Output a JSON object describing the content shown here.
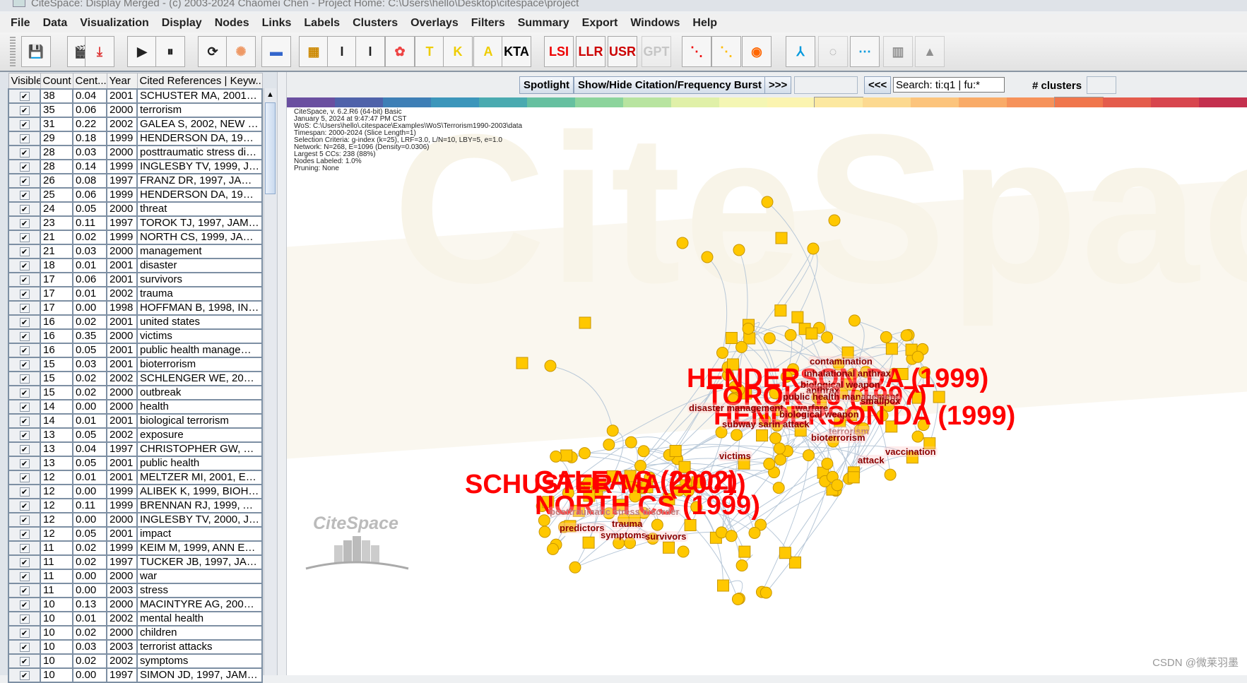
{
  "window": {
    "title": "CiteSpace: Display Merged - (c) 2003-2024 Chaomei Chen - Project Home: C:\\Users\\hello\\Desktop\\citespace\\project"
  },
  "menu": [
    "File",
    "Data",
    "Visualization",
    "Display",
    "Nodes",
    "Links",
    "Labels",
    "Clusters",
    "Overlays",
    "Filters",
    "Summary",
    "Export",
    "Windows",
    "Help"
  ],
  "toolbar": [
    {
      "icon": "save-icon",
      "label": ""
    },
    {
      "icon": "clapperboard-icon",
      "label": ""
    },
    {
      "icon": "pdf-export-icon",
      "label": ""
    },
    {
      "icon": "play-icon",
      "label": ""
    },
    {
      "icon": "pause-icon",
      "label": ""
    },
    {
      "icon": "refresh-icon",
      "label": ""
    },
    {
      "icon": "spiral-layout-icon",
      "label": ""
    },
    {
      "icon": "color-bar-icon",
      "label": ""
    },
    {
      "icon": "color-palette-icon",
      "label": ""
    },
    {
      "icon": "node-size-large-icon",
      "label": ""
    },
    {
      "icon": "node-size-small-icon",
      "label": ""
    },
    {
      "icon": "cluster-color-icon",
      "label": ""
    },
    {
      "icon": "title-label-icon",
      "label": ""
    },
    {
      "icon": "keyword-label-icon",
      "label": ""
    },
    {
      "icon": "abstract-label-icon",
      "label": ""
    },
    {
      "icon": "kta-icon",
      "label": "KTA"
    },
    {
      "icon": "lsi-icon",
      "label": "LSI"
    },
    {
      "icon": "llr-icon",
      "label": "LLR"
    },
    {
      "icon": "usr-icon",
      "label": "USR"
    },
    {
      "icon": "gpt-icon",
      "label": "GPT"
    },
    {
      "icon": "rgb-nodes-icon",
      "label": ""
    },
    {
      "icon": "yellow-nodes-icon",
      "label": ""
    },
    {
      "icon": "ring-icon",
      "label": ""
    },
    {
      "icon": "tree-layout-icon",
      "label": ""
    },
    {
      "icon": "circle-layout-icon",
      "label": ""
    },
    {
      "icon": "timeline-icon",
      "label": ""
    },
    {
      "icon": "timezone-icon",
      "label": ""
    },
    {
      "icon": "landscape-icon",
      "label": ""
    }
  ],
  "table": {
    "headers": [
      "Visible",
      "Count",
      "Cent...",
      "Year",
      "Cited References | Keyw..."
    ],
    "rows": [
      [
        38,
        "0.04",
        2001,
        "SCHUSTER MA, 2001, N..."
      ],
      [
        35,
        "0.06",
        2000,
        "terrorism"
      ],
      [
        31,
        "0.22",
        2002,
        "GALEA S, 2002, NEW E..."
      ],
      [
        29,
        "0.18",
        1999,
        "HENDERSON DA, 1999,..."
      ],
      [
        28,
        "0.03",
        2000,
        "posttraumatic stress disor..."
      ],
      [
        28,
        "0.14",
        1999,
        "INGLESBY TV, 1999, JA..."
      ],
      [
        26,
        "0.08",
        1997,
        "FRANZ DR, 1997, JAMA-..."
      ],
      [
        25,
        "0.06",
        1999,
        "HENDERSON DA, 1999,..."
      ],
      [
        24,
        "0.05",
        2000,
        "threat"
      ],
      [
        23,
        "0.11",
        1997,
        "TOROK TJ, 1997, JAMA..."
      ],
      [
        21,
        "0.02",
        1999,
        "NORTH CS, 1999, JAMA..."
      ],
      [
        21,
        "0.03",
        2000,
        "management"
      ],
      [
        18,
        "0.01",
        2001,
        "disaster"
      ],
      [
        17,
        "0.06",
        2001,
        "survivors"
      ],
      [
        17,
        "0.01",
        2002,
        "trauma"
      ],
      [
        17,
        "0.00",
        1998,
        "HOFFMAN B, 1998, INSI..."
      ],
      [
        16,
        "0.02",
        2001,
        "united states"
      ],
      [
        16,
        "0.35",
        2000,
        "victims"
      ],
      [
        16,
        "0.05",
        2001,
        "public health management"
      ],
      [
        15,
        "0.03",
        2001,
        "bioterrorism"
      ],
      [
        15,
        "0.02",
        2002,
        "SCHLENGER WE, 2002..."
      ],
      [
        15,
        "0.02",
        2000,
        "outbreak"
      ],
      [
        14,
        "0.00",
        2000,
        "health"
      ],
      [
        14,
        "0.01",
        2001,
        "biological terrorism"
      ],
      [
        13,
        "0.05",
        2002,
        "exposure"
      ],
      [
        13,
        "0.04",
        1997,
        "CHRISTOPHER GW, 19..."
      ],
      [
        13,
        "0.05",
        2001,
        "public health"
      ],
      [
        12,
        "0.01",
        2001,
        "MELTZER MI, 2001, EME..."
      ],
      [
        12,
        "0.00",
        1999,
        "ALIBEK K, 1999, BIOHAZ..."
      ],
      [
        12,
        "0.11",
        1999,
        "BRENNAN RJ, 1999, AN..."
      ],
      [
        12,
        "0.00",
        2000,
        "INGLESBY TV, 2000, JA..."
      ],
      [
        12,
        "0.05",
        2001,
        "impact"
      ],
      [
        11,
        "0.02",
        1999,
        "KEIM M, 1999, ANN EME..."
      ],
      [
        11,
        "0.02",
        1997,
        "TUCKER JB, 1997, JAM..."
      ],
      [
        11,
        "0.00",
        2000,
        "war"
      ],
      [
        11,
        "0.00",
        2003,
        "stress"
      ],
      [
        10,
        "0.13",
        2000,
        "MACINTYRE AG, 2000, J..."
      ],
      [
        10,
        "0.01",
        2002,
        "mental health"
      ],
      [
        10,
        "0.02",
        2000,
        "children"
      ],
      [
        10,
        "0.03",
        2003,
        "terrorist attacks"
      ],
      [
        10,
        "0.02",
        2002,
        "symptoms"
      ],
      [
        10,
        "0.00",
        1997,
        "SIMON JD, 1997, JAMA..."
      ]
    ]
  },
  "controls": {
    "spotlight": "Spotlight",
    "burst": "Show/Hide Citation/Frequency Burst",
    "next": ">>>",
    "prev": "<<<",
    "search_value": "Search: ti:q1 | fu:*",
    "clusters_label": "# clusters"
  },
  "colorbar": [
    "#6a4fa0",
    "#4f62aa",
    "#3e7fb6",
    "#3c96bb",
    "#4aaab0",
    "#66c0a0",
    "#8cd49c",
    "#b8e4a0",
    "#e0f0a8",
    "#f4f6b4",
    "#fbf4b0",
    "#fce8a0",
    "#fcd990",
    "#fcc47c",
    "#f9ab68",
    "#f6925a",
    "#f0764c",
    "#e45c4c",
    "#d8464e",
    "#c4304e"
  ],
  "info": [
    "CiteSpace, v. 6.2.R6 (64-bit) Basic",
    "January 5, 2024 at 9:47:47 PM CST",
    "WoS: C:\\Users\\hello\\.citespace\\Examples\\WoS\\Terrorism1990-2003\\data",
    "Timespan: 2000-2024 (Slice Length=1)",
    "Selection Criteria: g-index (k=25), LRF=3.0, L/N=10, LBY=5, e=1.0",
    "Network: N=268, E=1096 (Density=0.0306)",
    "Largest 5 CCs: 238 (88%)",
    "Nodes Labeled: 1.0%",
    "Pruning: None"
  ],
  "network": {
    "reference_labels": [
      "HENDERSON DA (1999)",
      "TOROK TJ (1997)",
      "HENDERSON DA (1999)",
      "SCHUSTER MA (2001)",
      "GALEA S (2002)",
      "NORTH CS (1999)"
    ],
    "keyword_labels": [
      "contamination",
      "inhalational anthrax",
      "biological weapon",
      "anthrax",
      "public health management",
      "smallpox",
      "disaster management",
      "warfare",
      "biological weapon",
      "subway sarin attack",
      "terrorism",
      "bioterrorism",
      "victims",
      "attack",
      "vaccination",
      "posttraumatic stress disorder",
      "predictors",
      "trauma",
      "symptoms",
      "survivors"
    ],
    "node_color": "#ffc800",
    "label_color": "#ff0000"
  },
  "logo": "CiteSpace",
  "watermark": "CiteSpace",
  "footer_watermark": "CSDN @微莱羽墨"
}
